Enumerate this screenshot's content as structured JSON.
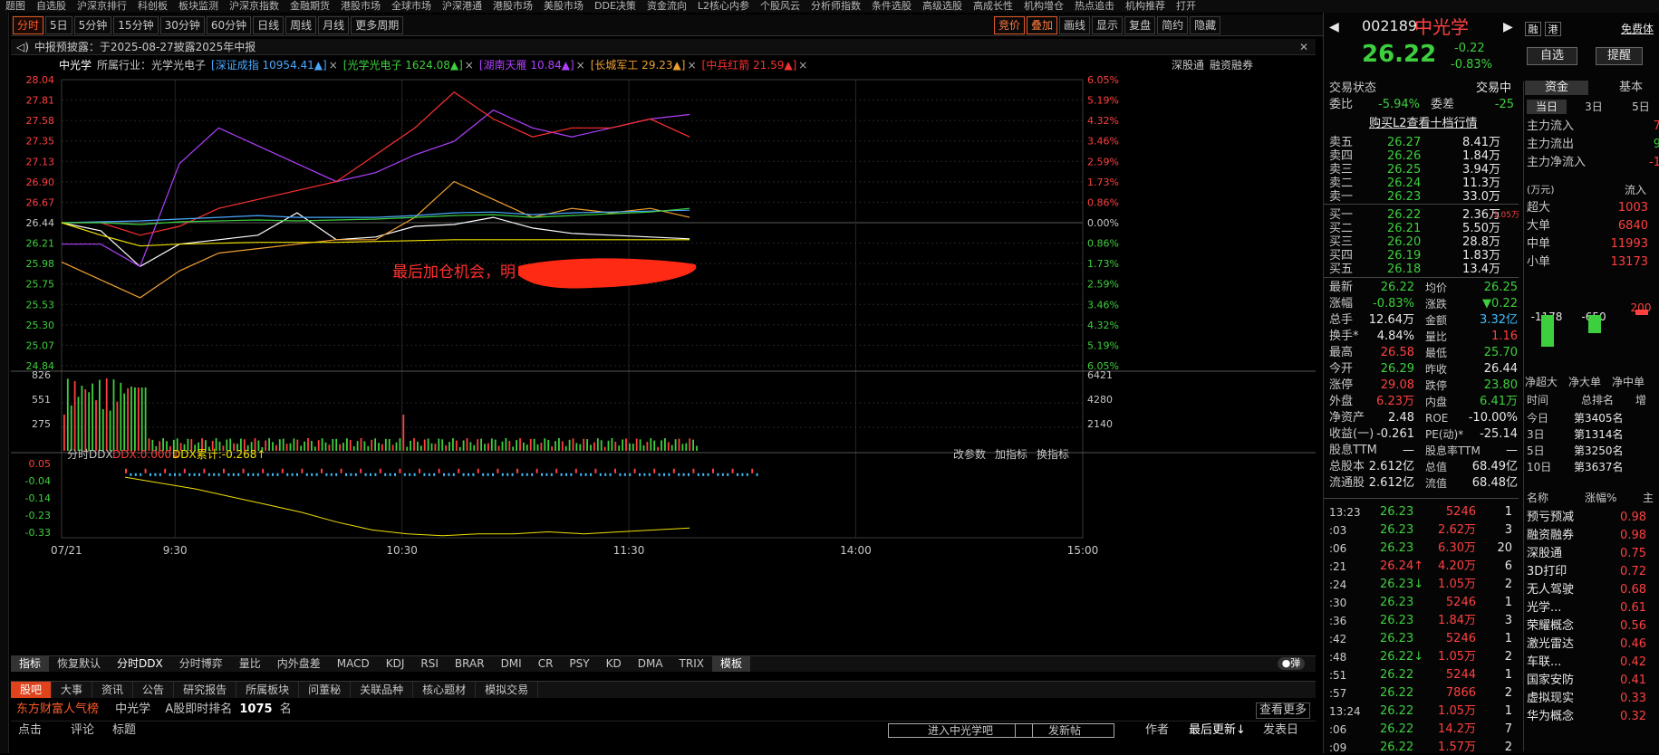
{
  "top_menu": [
    "题图",
    "自选股",
    "沪深京排行",
    "科创板",
    "板块监测",
    "沪深京指数",
    "金融期货",
    "港股市场",
    "全球市场",
    "沪深港通",
    "港股市场",
    "美股市场",
    "DDE决策",
    "资金流向",
    "L2核心内参",
    "个股风云",
    "分析师指数",
    "条件选股",
    "高级选股",
    "高成长性",
    "机构增仓",
    "热点追击",
    "机构推荐",
    "打开"
  ],
  "toolbar": {
    "buttons": [
      "分时",
      "5日",
      "5分钟",
      "15分钟",
      "30分钟",
      "60分钟",
      "日线",
      "周线",
      "月线",
      "更多周期"
    ],
    "right_buttons": [
      "竞价",
      "叠加",
      "画线",
      "显示",
      "复盘",
      "简约",
      "隐藏"
    ]
  },
  "notice": {
    "text": "中报预披露：于2025-08-27披露2025年中报"
  },
  "legend": {
    "stock": "中光学",
    "industry_label": "所属行业：光学光电子",
    "items": [
      {
        "label": "[深证成指 10954.41▲]",
        "color": "#4aa8ff"
      },
      {
        "label": "[光学光电子 1624.08▲]",
        "color": "#3ecf3e"
      },
      {
        "label": "[湖南天雁 10.84▲]",
        "color": "#b040ff"
      },
      {
        "label": "[长城军工 29.23▲]",
        "color": "#f0a030"
      },
      {
        "label": "[中兵红箭 21.59▲]",
        "color": "#ff3030"
      }
    ],
    "right": [
      "深股通",
      "融资融券"
    ]
  },
  "annotation": "最后加仓机会，明",
  "chart_data": {
    "type": "line",
    "price_axis": {
      "left_ticks": [
        "28.04",
        "27.81",
        "27.58",
        "27.35",
        "27.13",
        "26.90",
        "26.67",
        "26.44",
        "26.21",
        "25.98",
        "25.75",
        "25.53",
        "25.30",
        "25.07",
        "24.84"
      ],
      "right_ticks": [
        "6.05%",
        "5.19%",
        "4.32%",
        "3.46%",
        "2.59%",
        "1.73%",
        "0.86%",
        "0.00%",
        "0.86%",
        "1.73%",
        "2.59%",
        "3.46%",
        "4.32%",
        "5.19%",
        "6.05%"
      ]
    },
    "volume_axis": {
      "left_ticks": [
        "826",
        "551",
        "275"
      ],
      "right_ticks": [
        "6421",
        "4280",
        "2140"
      ]
    },
    "ddx_axis": {
      "left_ticks": [
        "0.05",
        "-0.04",
        "-0.14",
        "-0.23",
        "-0.33"
      ]
    },
    "time_ticks": [
      "07/21",
      "9:30",
      "10:30",
      "11:30",
      "14:00",
      "15:00"
    ],
    "series": [
      {
        "name": "中光学",
        "color": "#ffffff",
        "values": [
          26.44,
          26.35,
          25.95,
          26.2,
          26.25,
          26.3,
          26.55,
          26.25,
          26.28,
          26.4,
          26.42,
          26.5,
          26.38,
          26.32,
          26.3,
          26.28,
          26.26
        ]
      },
      {
        "name": "湖南天雁",
        "color": "#b040ff",
        "values": [
          26.2,
          26.2,
          25.95,
          27.1,
          27.5,
          27.3,
          27.1,
          26.9,
          27.0,
          27.2,
          27.35,
          27.7,
          27.5,
          27.4,
          27.5,
          27.6,
          27.65
        ]
      },
      {
        "name": "中兵红箭",
        "color": "#ff3030",
        "values": [
          26.44,
          26.44,
          26.3,
          26.4,
          26.6,
          26.7,
          26.8,
          26.9,
          27.2,
          27.5,
          27.9,
          27.6,
          27.4,
          27.5,
          27.5,
          27.6,
          27.4
        ]
      },
      {
        "name": "长城军工",
        "color": "#f0a030",
        "values": [
          26.0,
          25.8,
          25.6,
          25.9,
          26.1,
          26.15,
          26.2,
          26.25,
          26.25,
          26.5,
          26.9,
          26.7,
          26.5,
          26.6,
          26.55,
          26.6,
          26.5
        ]
      },
      {
        "name": "深证成指",
        "color": "#4aa8ff",
        "values": [
          26.44,
          26.45,
          26.46,
          26.48,
          26.5,
          26.52,
          26.5,
          26.5,
          26.5,
          26.52,
          26.55,
          26.56,
          26.53,
          26.55,
          26.56,
          26.57,
          26.58
        ]
      },
      {
        "name": "光学光电子",
        "color": "#3ecf3e",
        "values": [
          26.44,
          26.44,
          26.42,
          26.45,
          26.46,
          26.47,
          26.46,
          26.47,
          26.48,
          26.5,
          26.52,
          26.53,
          26.5,
          26.52,
          26.54,
          26.56,
          26.6
        ]
      },
      {
        "name": "均价",
        "color": "#f0e000",
        "values": [
          26.44,
          26.3,
          26.18,
          26.2,
          26.21,
          26.22,
          26.22,
          26.22,
          26.23,
          26.24,
          26.25,
          26.25,
          26.25,
          26.25,
          26.25,
          26.25,
          26.25
        ]
      }
    ],
    "ddx": {
      "label": "分时DDX",
      "ddx_value": "DDX:0.000↓",
      "ddx_cum": "DDX累计:-0.268↑",
      "values": [
        -0.02,
        -0.05,
        -0.08,
        -0.12,
        -0.16,
        -0.2,
        -0.25,
        -0.29,
        -0.31,
        -0.32,
        -0.31,
        -0.31,
        -0.3,
        -0.31,
        -0.3,
        -0.29,
        -0.28
      ]
    },
    "ddx_right": [
      "改参数",
      "加指标",
      "换指标"
    ]
  },
  "indicator_tabs": [
    "指标",
    "恢复默认",
    "分时DDX",
    "分时博弈",
    "量比",
    "内外盘差",
    "MACD",
    "KDJ",
    "RSI",
    "BRAR",
    "DMI",
    "CR",
    "PSY",
    "KD",
    "DMA",
    "TRIX",
    "模板"
  ],
  "pop_label": "弹",
  "news_tabs": [
    "股吧",
    "大事",
    "资讯",
    "公告",
    "研究报告",
    "所属板块",
    "问董秘",
    "关联品种",
    "核心题材",
    "模拟交易"
  ],
  "news": {
    "brand": "东方财富人气榜",
    "stock": "中光学",
    "rank_label": "A股即时排名",
    "rank": "1075",
    "rank_unit": "名",
    "more": "查看更多",
    "cols": [
      "点击",
      "评论",
      "标题"
    ],
    "enter_btn": "进入中光学吧",
    "post_btn": "发新帖",
    "author": "作者",
    "latest": "最后更新↓",
    "post_date": "发表日"
  },
  "quote": {
    "code": "002189",
    "name": "中光学",
    "price": "26.22",
    "change": "-0.22",
    "pct": "-0.83%",
    "badges": [
      "融",
      "港"
    ],
    "free": "免费体",
    "zixuan": "自选",
    "tixing": "提醒",
    "status_label": "交易状态",
    "status": "交易中",
    "webi_label": "委比",
    "webi": "-5.94%",
    "weicha_label": "委差",
    "weicha": "-25",
    "l2": "购买L2查看十档行情",
    "sells": [
      {
        "l": "卖五",
        "p": "26.27",
        "v": "8.41万"
      },
      {
        "l": "卖四",
        "p": "26.26",
        "v": "1.84万"
      },
      {
        "l": "卖三",
        "p": "26.25",
        "v": "3.94万"
      },
      {
        "l": "卖二",
        "p": "26.24",
        "v": "11.3万"
      },
      {
        "l": "卖一",
        "p": "26.23",
        "v": "33.0万"
      }
    ],
    "buys": [
      {
        "l": "买一",
        "p": "26.22",
        "v": "2.36万",
        "x": "-1.05万"
      },
      {
        "l": "买二",
        "p": "26.21",
        "v": "5.50万"
      },
      {
        "l": "买三",
        "p": "26.20",
        "v": "28.8万"
      },
      {
        "l": "买四",
        "p": "26.19",
        "v": "1.83万"
      },
      {
        "l": "买五",
        "p": "26.18",
        "v": "13.4万"
      }
    ],
    "stats": [
      [
        "最新",
        "26.22",
        "均价",
        "26.25"
      ],
      [
        "涨幅",
        "-0.83%",
        "涨跌",
        "▼0.22"
      ],
      [
        "总手",
        "12.64万",
        "金额",
        "3.32亿"
      ],
      [
        "换手*",
        "4.84%",
        "量比",
        "1.16"
      ],
      [
        "最高",
        "26.58",
        "最低",
        "25.70"
      ],
      [
        "今开",
        "26.29",
        "昨收",
        "26.44"
      ],
      [
        "涨停",
        "29.08",
        "跌停",
        "23.80"
      ],
      [
        "外盘",
        "6.23万",
        "内盘",
        "6.41万"
      ],
      [
        "净资产",
        "2.48",
        "ROE",
        "-10.00%"
      ],
      [
        "收益(一)",
        "-0.261",
        "PE(动)*",
        "-25.14"
      ],
      [
        "股息TTM",
        "—",
        "股息率TTM",
        "—"
      ],
      [
        "总股本",
        "2.612亿",
        "总值",
        "68.49亿"
      ],
      [
        "流通股",
        "2.612亿",
        "流值",
        "68.48亿"
      ]
    ],
    "ticks": [
      [
        "13:23",
        "26.23",
        "5246",
        "1"
      ],
      [
        ":03",
        "26.23",
        "2.62万",
        "3"
      ],
      [
        ":06",
        "26.23",
        "6.30万",
        "20"
      ],
      [
        ":21",
        "26.24↑",
        "4.20万",
        "6"
      ],
      [
        ":24",
        "26.23↓",
        "1.05万",
        "2"
      ],
      [
        ":30",
        "26.23",
        "5246",
        "1"
      ],
      [
        ":36",
        "26.23",
        "1.84万",
        "3"
      ],
      [
        ":42",
        "26.23",
        "5246",
        "1"
      ],
      [
        ":48",
        "26.22↓",
        "1.05万",
        "2"
      ],
      [
        ":51",
        "26.22",
        "5244",
        "1"
      ],
      [
        ":57",
        "26.22",
        "7866",
        "2"
      ],
      [
        "13:24",
        "26.22",
        "1.05万",
        "1"
      ],
      [
        ":06",
        "26.22",
        "14.2万",
        "7"
      ],
      [
        ":09",
        "26.22",
        "1.57万",
        "2"
      ]
    ]
  },
  "fund": {
    "tabs": [
      "资金",
      "基本"
    ],
    "periods": [
      "当日",
      "3日",
      "5日"
    ],
    "flows": [
      [
        "主力流入",
        "7"
      ],
      [
        "主力流出",
        "9"
      ],
      [
        "主力净流入",
        "-1"
      ]
    ],
    "unit": "(万元)",
    "unit2": "流入",
    "sizes": [
      [
        "超大",
        "1003"
      ],
      [
        "大单",
        "6840"
      ],
      [
        "中单",
        "11993"
      ],
      [
        "小单",
        "13173"
      ]
    ],
    "bars": [
      {
        "label": "-1178",
        "v": -1178
      },
      {
        "label": "-650",
        "v": -650
      },
      {
        "label": "200",
        "v": 200
      }
    ],
    "bar_labels": [
      "净超大",
      "净大单",
      "净中单"
    ],
    "rank_head": [
      "时间",
      "总排名",
      "增"
    ],
    "ranks": [
      [
        "今日",
        "第3405名"
      ],
      [
        "3日",
        "第1314名"
      ],
      [
        "5日",
        "第3250名"
      ],
      [
        "10日",
        "第3637名"
      ]
    ],
    "concept_head": [
      "名称",
      "涨幅%",
      "主"
    ],
    "concepts": [
      [
        "预亏预减",
        "0.98"
      ],
      [
        "融资融券",
        "0.98"
      ],
      [
        "深股通",
        "0.75"
      ],
      [
        "3D打印",
        "0.72"
      ],
      [
        "无人驾驶",
        "0.68"
      ],
      [
        "光学...",
        "0.61"
      ],
      [
        "荣耀概念",
        "0.56"
      ],
      [
        "激光雷达",
        "0.46"
      ],
      [
        "车联...",
        "0.42"
      ],
      [
        "国家安防",
        "0.41"
      ],
      [
        "虚拟现实",
        "0.33"
      ],
      [
        "华为概念",
        "0.32"
      ]
    ]
  }
}
